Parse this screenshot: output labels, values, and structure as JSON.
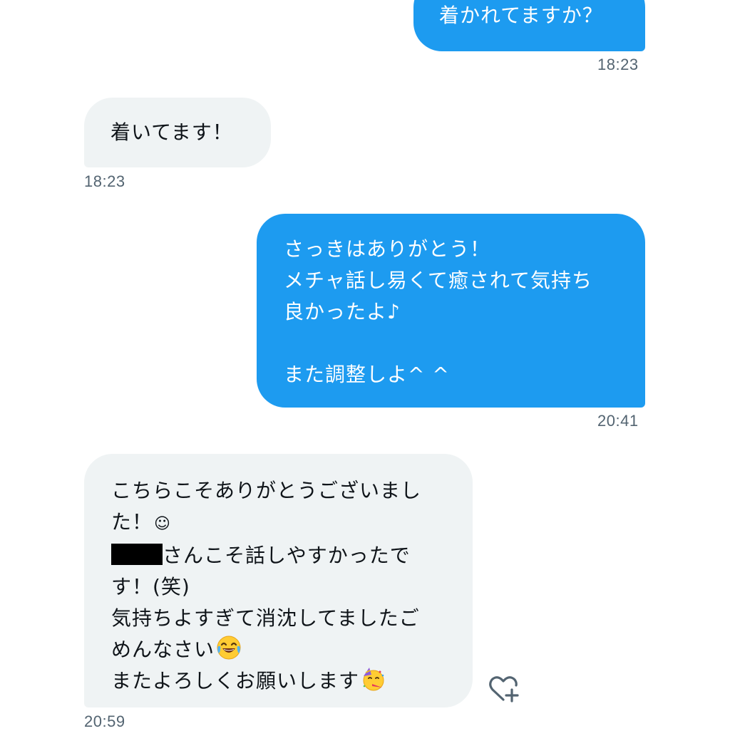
{
  "messages": [
    {
      "direction": "outgoing",
      "lines": [
        "着かれてますか？"
      ],
      "time": "18:23"
    },
    {
      "direction": "incoming",
      "lines": [
        "着いてます！"
      ],
      "time": "18:23"
    },
    {
      "direction": "outgoing",
      "lines": [
        "さっきはありがとう！",
        "メチャ話し易くて癒されて気持ち",
        "良かったよ♪",
        "",
        "また調整しよ^ ^"
      ],
      "time": "20:41"
    },
    {
      "direction": "incoming",
      "lines": [
        "こちらこそありがとうございまし",
        "た！",
        "さんこそ話しやすかったで",
        "す！(笑)",
        "気持ちよすぎて消沈してましたご",
        "めんなさい",
        "またよろしくお願いします"
      ],
      "time": "20:59"
    }
  ],
  "icons": {
    "smile": "☺",
    "tears_of_joy": "face-with-tears-of-joy-icon",
    "partying_face": "partying-face-icon",
    "react": "heart-plus-icon"
  },
  "colors": {
    "outgoing_bubble": "#1d9bf0",
    "incoming_bubble": "#eff3f4",
    "timestamp": "#536471"
  }
}
